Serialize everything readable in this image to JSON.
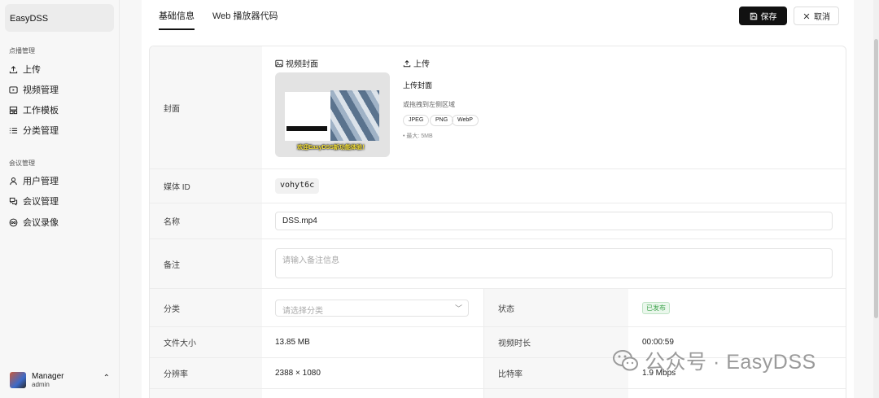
{
  "sidebar": {
    "brand": "EasyDSS",
    "groups": [
      {
        "label": "点播管理",
        "items": [
          {
            "label": "上传",
            "icon": "upload-icon"
          },
          {
            "label": "视频管理",
            "icon": "video-icon"
          },
          {
            "label": "工作模板",
            "icon": "template-icon"
          },
          {
            "label": "分类管理",
            "icon": "list-icon"
          }
        ]
      },
      {
        "label": "会议管理",
        "items": [
          {
            "label": "用户管理",
            "icon": "user-icon"
          },
          {
            "label": "会议管理",
            "icon": "meeting-icon"
          },
          {
            "label": "会议录像",
            "icon": "record-icon"
          }
        ]
      }
    ],
    "user": {
      "name": "Manager",
      "role": "admin"
    }
  },
  "tabs": [
    {
      "label": "基础信息",
      "active": true
    },
    {
      "label": "Web 播放器代码",
      "active": false
    }
  ],
  "actions": {
    "save": "保存",
    "cancel": "取消"
  },
  "form": {
    "cover": {
      "label": "封面",
      "cover_title": "视频封面",
      "upload_title": "上传",
      "thumb_caption": "欢迎EasyDSS新功能体验！",
      "upload_heading": "上传封面",
      "upload_hint": "或拖拽到左侧区域",
      "formats": [
        "JPEG",
        "PNG",
        "WebP"
      ],
      "max_size": "• 最大: 5MB"
    },
    "media_id": {
      "label": "媒体 ID",
      "value": "vohyt6c"
    },
    "name": {
      "label": "名称",
      "value": "DSS.mp4"
    },
    "note": {
      "label": "备注",
      "placeholder": "请输入备注信息"
    },
    "category": {
      "label": "分类",
      "placeholder": "请选择分类"
    },
    "status": {
      "label": "状态",
      "value": "已发布"
    },
    "file_size": {
      "label": "文件大小",
      "value": "13.85 MB"
    },
    "duration": {
      "label": "视频时长",
      "value": "00:00:59"
    },
    "resolution": {
      "label": "分辨率",
      "value": "2388 × 1080"
    },
    "bitrate": {
      "label": "比特率",
      "value": "1.9 Mbps"
    }
  },
  "watermark": "公众号 · EasyDSS",
  "colors": {
    "primary": "#111111",
    "status_green": "#3fa34d",
    "label_bg": "#f7f7f7"
  }
}
